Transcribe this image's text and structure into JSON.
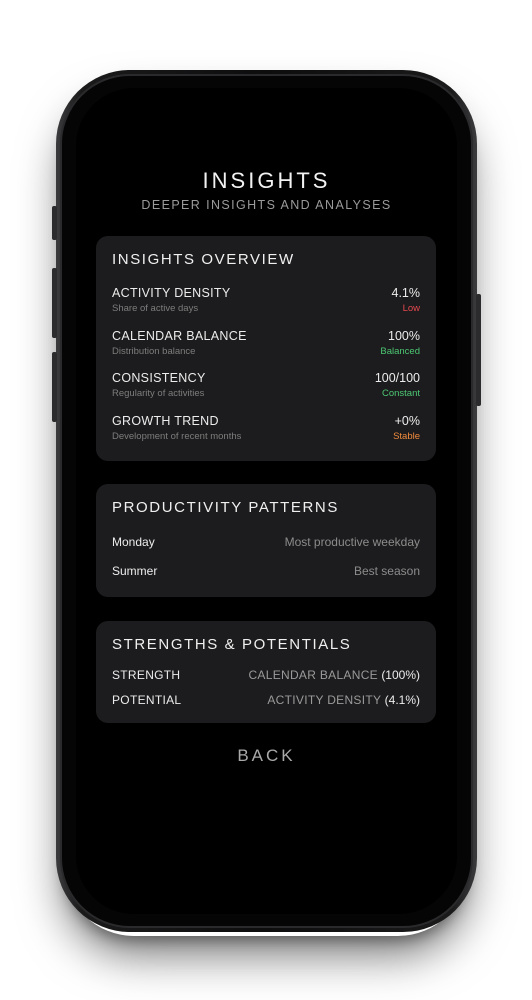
{
  "header": {
    "title": "INSIGHTS",
    "subtitle": "DEEPER INSIGHTS AND ANALYSES"
  },
  "overview": {
    "title": "INSIGHTS OVERVIEW",
    "metrics": [
      {
        "name": "ACTIVITY DENSITY",
        "description": "Share of active days",
        "value": "4.1%",
        "status": "Low",
        "status_color": "#e5484d"
      },
      {
        "name": "CALENDAR BALANCE",
        "description": "Distribution balance",
        "value": "100%",
        "status": "Balanced",
        "status_color": "#4cc772"
      },
      {
        "name": "CONSISTENCY",
        "description": "Regularity of activities",
        "value": "100/100",
        "status": "Constant",
        "status_color": "#4cc772"
      },
      {
        "name": "GROWTH TREND",
        "description": "Development of recent months",
        "value": "+0%",
        "status": "Stable",
        "status_color": "#f08a3c"
      }
    ]
  },
  "patterns": {
    "title": "PRODUCTIVITY PATTERNS",
    "rows": [
      {
        "key": "Monday",
        "value": "Most productive weekday"
      },
      {
        "key": "Summer",
        "value": "Best season"
      }
    ]
  },
  "strengths": {
    "title": "STRENGTHS & POTENTIALS",
    "rows": [
      {
        "key": "STRENGTH",
        "name": "CALENDAR BALANCE",
        "pct": "(100%)"
      },
      {
        "key": "POTENTIAL",
        "name": "ACTIVITY DENSITY",
        "pct": "(4.1%)"
      }
    ]
  },
  "back_label": "BACK"
}
